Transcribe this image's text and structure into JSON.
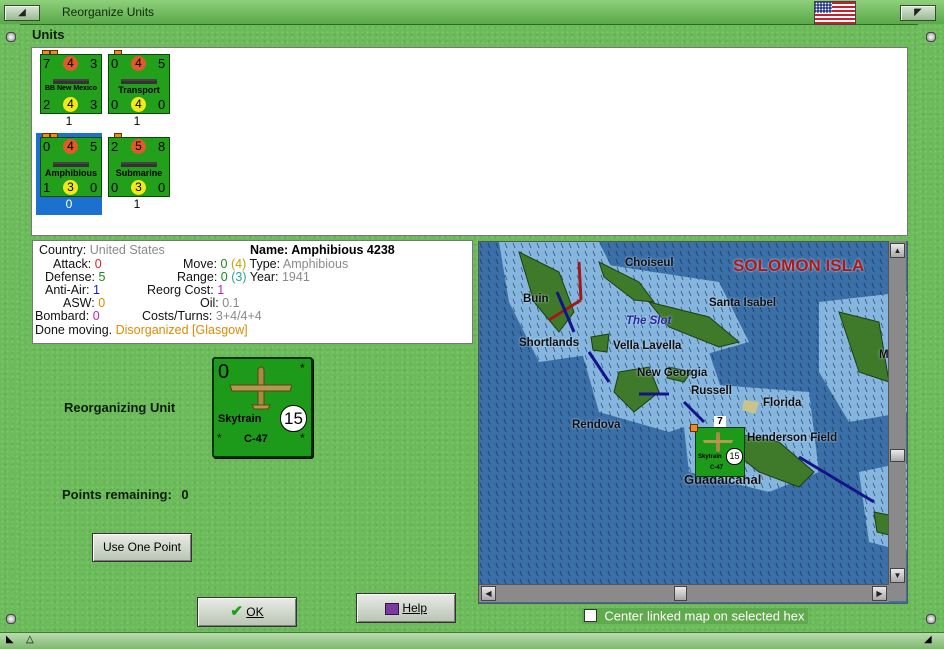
{
  "window": {
    "title": "Reorganize Units"
  },
  "units_section": {
    "label": "Units",
    "units": [
      {
        "name": "BB New Mexico",
        "attack": "7",
        "center_top": "4",
        "move": "3",
        "defense": "2",
        "center_bottom": "4",
        "range": "3",
        "count": "1",
        "selected": false
      },
      {
        "name": "Transport",
        "attack": "0",
        "center_top": "4",
        "move": "5",
        "defense": "0",
        "center_bottom": "4",
        "range": "0",
        "count": "1",
        "selected": false
      },
      {
        "name": "Amphibious",
        "attack": "0",
        "center_top": "4",
        "move": "5",
        "defense": "1",
        "center_bottom": "3",
        "range": "0",
        "count": "0",
        "selected": true
      },
      {
        "name": "Submarine",
        "attack": "2",
        "center_top": "5",
        "move": "8",
        "defense": "0",
        "center_bottom": "3",
        "range": "0",
        "count": "1",
        "selected": false
      }
    ]
  },
  "details": {
    "country_label": "Country:",
    "country": "United States",
    "attack_label": "Attack:",
    "attack": "0",
    "defense_label": "Defense:",
    "defense": "5",
    "antiair_label": "Anti-Air:",
    "antiair": "1",
    "asw_label": "ASW:",
    "asw": "0",
    "bombard_label": "Bombard:",
    "bombard": "0",
    "name_label": "Name:",
    "name": "Amphibious 4238",
    "move_label": "Move:",
    "move": "0",
    "move_paren": "(4)",
    "type_label": "Type:",
    "type": "Amphibious",
    "range_label": "Range:",
    "range": "0",
    "range_paren": "(3)",
    "year_label": "Year:",
    "year": "1941",
    "reorg_label": "Reorg Cost:",
    "reorg": "1",
    "oil_label": "Oil:",
    "oil": "0.1",
    "costs_label": "Costs/Turns:",
    "costs": "3+4/4+4",
    "status": "Done moving.",
    "status_extra": "Disorganized [Glasgow]"
  },
  "reorganizing": {
    "label": "Reorganizing Unit",
    "unit": {
      "attack": "0",
      "name": "Skytrain",
      "model": "C-47",
      "strength": "15"
    },
    "points_label": "Points remaining:",
    "points": "0",
    "use_button": "Use One Point"
  },
  "buttons": {
    "ok": "OK",
    "help": "Help"
  },
  "map": {
    "title": "SOLOMON ISLA",
    "places": [
      "Choiseul",
      "Buin",
      "Santa Isabel",
      "The Slot",
      "Shortlands",
      "Vella Lavella",
      "New Georgia",
      "Russell",
      "Florida",
      "Rendova",
      "Henderson Field",
      "Guadalcanal",
      "M"
    ],
    "unit": {
      "name": "Skytrain",
      "model": "C-47",
      "strength": "15",
      "stack": "7"
    },
    "checkbox_label": "Center linked map on selected hex"
  },
  "colors": {
    "accent_green": "#22a01c",
    "selected_blue": "#1c70d0",
    "map_title_red": "#b01818"
  }
}
